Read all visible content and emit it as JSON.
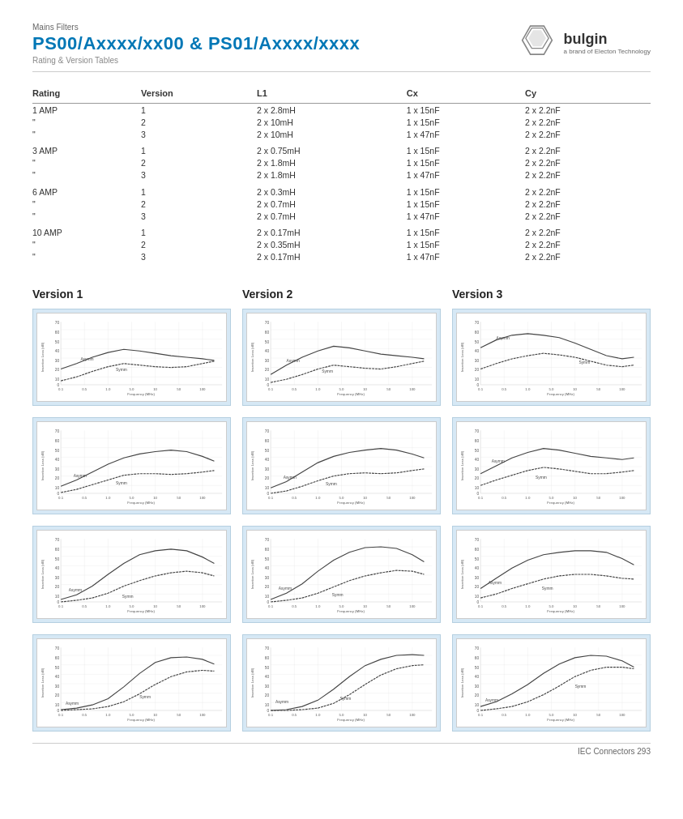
{
  "header": {
    "category": "Mains Filters",
    "title": "PS00/Axxxx/xx00 & PS01/Axxxx/xxxx",
    "subtitle": "Rating & Version Tables",
    "logo": {
      "brand": "bulgin",
      "tagline": "a brand of Electon Technology"
    }
  },
  "table": {
    "columns": [
      "Rating",
      "Version",
      "L1",
      "Cx",
      "Cy"
    ],
    "groups": [
      {
        "rows": [
          {
            "rating": "1 AMP",
            "version": "1",
            "l1": "2 x 2.8mH",
            "cx": "1 x 15nF",
            "cy": "2 x 2.2nF"
          },
          {
            "rating": "\"",
            "version": "2",
            "l1": "2 x 10mH",
            "cx": "1 x 15nF",
            "cy": "2 x 2.2nF"
          },
          {
            "rating": "\"",
            "version": "3",
            "l1": "2 x 10mH",
            "cx": "1 x 47nF",
            "cy": "2 x 2.2nF"
          }
        ]
      },
      {
        "rows": [
          {
            "rating": "3 AMP",
            "version": "1",
            "l1": "2 x 0.75mH",
            "cx": "1 x 15nF",
            "cy": "2 x 2.2nF"
          },
          {
            "rating": "\"",
            "version": "2",
            "l1": "2 x 1.8mH",
            "cx": "1 x 15nF",
            "cy": "2 x 2.2nF"
          },
          {
            "rating": "\"",
            "version": "3",
            "l1": "2 x 1.8mH",
            "cx": "1 x 47nF",
            "cy": "2 x 2.2nF"
          }
        ]
      },
      {
        "rows": [
          {
            "rating": "6 AMP",
            "version": "1",
            "l1": "2 x 0.3mH",
            "cx": "1 x 15nF",
            "cy": "2 x 2.2nF"
          },
          {
            "rating": "\"",
            "version": "2",
            "l1": "2 x 0.7mH",
            "cx": "1 x 15nF",
            "cy": "2 x 2.2nF"
          },
          {
            "rating": "\"",
            "version": "3",
            "l1": "2 x 0.7mH",
            "cx": "1 x 47nF",
            "cy": "2 x 2.2nF"
          }
        ]
      },
      {
        "rows": [
          {
            "rating": "10 AMP",
            "version": "1",
            "l1": "2 x 0.17mH",
            "cx": "1 x 15nF",
            "cy": "2 x 2.2nF"
          },
          {
            "rating": "\"",
            "version": "2",
            "l1": "2 x 0.35mH",
            "cx": "1 x 15nF",
            "cy": "2 x 2.2nF"
          },
          {
            "rating": "\"",
            "version": "3",
            "l1": "2 x 0.17mH",
            "cx": "1 x 47nF",
            "cy": "2 x 2.2nF"
          }
        ]
      }
    ]
  },
  "versions": [
    {
      "label": "Version 1"
    },
    {
      "label": "Version 2"
    },
    {
      "label": "Version 3"
    }
  ],
  "chart_rows": [
    {
      "row": 1,
      "asymm_label": "Asymm",
      "symm_label": "Symm"
    },
    {
      "row": 2,
      "asymm_label": "Asymm",
      "symm_label": "Symm"
    },
    {
      "row": 3,
      "asymm_label": "Asymm",
      "symm_label": "Symm"
    },
    {
      "row": 4,
      "asymm_label": "Asymm",
      "symm_label": "Symm"
    }
  ],
  "chart_labels": {
    "y_axis": "Insertion Loss (dB)",
    "x_axis": "Frequency (MHz)",
    "y_max": "70",
    "y_ticks": [
      "70",
      "60",
      "50",
      "40",
      "30",
      "20",
      "10",
      "0"
    ],
    "x_ticks": [
      "0.1",
      "0.5",
      "1.0",
      "5.0",
      "10",
      "50",
      "100"
    ]
  },
  "footer": {
    "text": "IEC Connectors  293"
  }
}
